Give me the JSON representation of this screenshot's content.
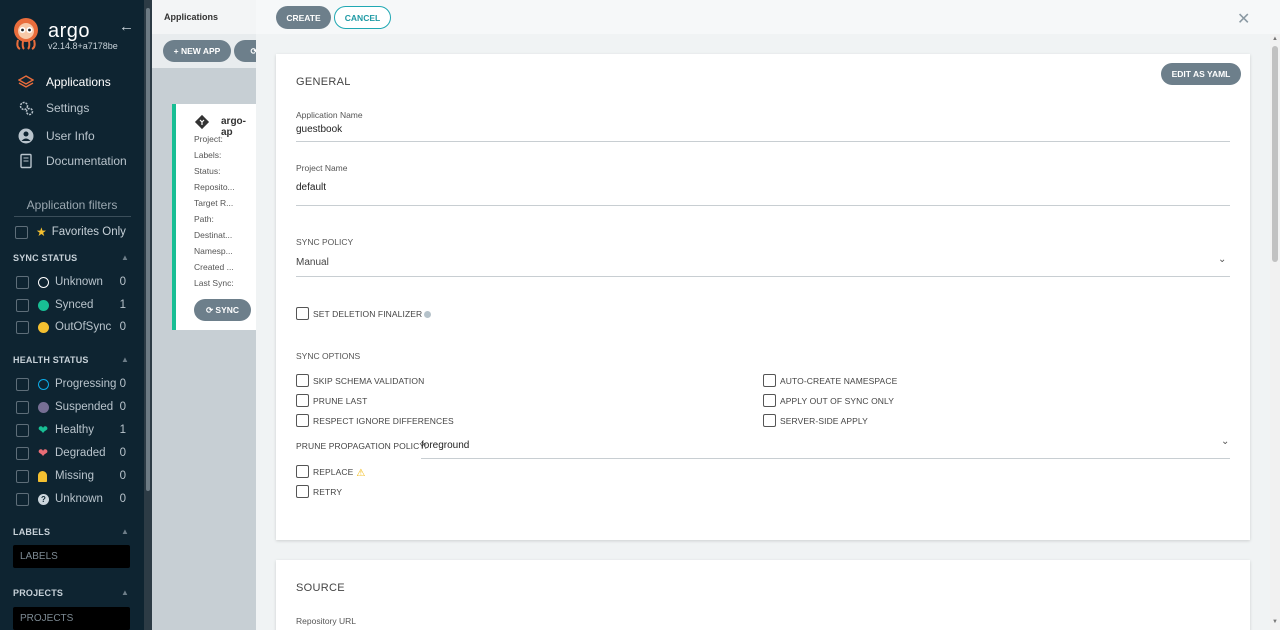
{
  "sidebar": {
    "brand": "argo",
    "version": "v2.14.8+a7178be",
    "nav": [
      {
        "label": "Applications",
        "icon": "layers-icon"
      },
      {
        "label": "Settings",
        "icon": "gears-icon"
      },
      {
        "label": "User Info",
        "icon": "user-icon"
      },
      {
        "label": "Documentation",
        "icon": "book-icon"
      }
    ],
    "filters_title": "Application filters",
    "favorites_label": "Favorites Only",
    "sync_status": {
      "title": "SYNC STATUS",
      "items": [
        {
          "label": "Unknown",
          "count": "0",
          "color": "#ffffff"
        },
        {
          "label": "Synced",
          "count": "1",
          "color": "#18be94"
        },
        {
          "label": "OutOfSync",
          "count": "0",
          "color": "#f4c030"
        }
      ]
    },
    "health_status": {
      "title": "HEALTH STATUS",
      "items": [
        {
          "label": "Progressing",
          "count": "0",
          "color": "#0dadea"
        },
        {
          "label": "Suspended",
          "count": "0",
          "color": "#766f94"
        },
        {
          "label": "Healthy",
          "count": "1",
          "color": "#18be94"
        },
        {
          "label": "Degraded",
          "count": "0",
          "color": "#e96d76"
        },
        {
          "label": "Missing",
          "count": "0",
          "color": "#f4c030"
        },
        {
          "label": "Unknown",
          "count": "0",
          "color": "#ccd6dd"
        }
      ]
    },
    "labels": {
      "title": "LABELS",
      "placeholder": "LABELS"
    },
    "projects": {
      "title": "PROJECTS",
      "placeholder": "PROJECTS"
    }
  },
  "main": {
    "title": "Applications",
    "new_app": "+ NEW APP",
    "card": {
      "name": "argo-ap",
      "rows": [
        "Project:",
        "Labels:",
        "Status:",
        "Reposito...",
        "Target R...",
        "Path:",
        "Destinat...",
        "Namesp...",
        "Created ...",
        "Last Sync:"
      ],
      "sync_button": "SYNC"
    }
  },
  "panel": {
    "create": "CREATE",
    "cancel": "CANCEL",
    "edit_yaml": "EDIT AS YAML",
    "general_title": "GENERAL",
    "app_name_label": "Application Name",
    "app_name_value": "guestbook",
    "project_label": "Project Name",
    "project_value": "default",
    "sync_policy_label": "SYNC POLICY",
    "sync_policy_value": "Manual",
    "deletion_finalizer": "SET DELETION FINALIZER",
    "sync_options_title": "SYNC OPTIONS",
    "sync_options_left": [
      "SKIP SCHEMA VALIDATION",
      "PRUNE LAST",
      "RESPECT IGNORE DIFFERENCES"
    ],
    "sync_options_right": [
      "AUTO-CREATE NAMESPACE",
      "APPLY OUT OF SYNC ONLY",
      "SERVER-SIDE APPLY"
    ],
    "prune_policy_label": "PRUNE PROPAGATION POLICY:",
    "prune_policy_value": "foreground",
    "replace": "REPLACE",
    "retry": "RETRY",
    "source_title": "SOURCE",
    "repo_url_label": "Repository URL"
  }
}
